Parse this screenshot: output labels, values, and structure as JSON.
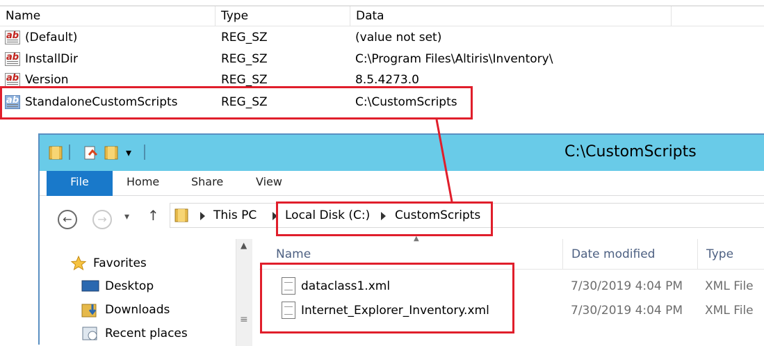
{
  "registry": {
    "columns": [
      "Name",
      "Type",
      "Data"
    ],
    "rows": [
      {
        "name": "(Default)",
        "type": "REG_SZ",
        "data": "(value not set)"
      },
      {
        "name": "InstallDir",
        "type": "REG_SZ",
        "data": "C:\\Program Files\\Altiris\\Inventory\\"
      },
      {
        "name": "Version",
        "type": "REG_SZ",
        "data": "8.5.4273.0"
      },
      {
        "name": "StandaloneCustomScripts",
        "type": "REG_SZ",
        "data": "C:\\CustomScripts"
      }
    ]
  },
  "explorer": {
    "title": "C:\\CustomScripts",
    "ribbon": {
      "file": "File",
      "tabs": [
        "Home",
        "Share",
        "View"
      ]
    },
    "breadcrumb": [
      "This PC",
      "Local Disk (C:)",
      "CustomScripts"
    ],
    "nav": {
      "favorites": "Favorites",
      "items": [
        "Desktop",
        "Downloads",
        "Recent places"
      ]
    },
    "columns": {
      "name": "Name",
      "date": "Date modified",
      "type": "Type"
    },
    "files": [
      {
        "name": "dataclass1.xml",
        "date": "7/30/2019 4:04 PM",
        "type": "XML File"
      },
      {
        "name": "Internet_Explorer_Inventory.xml",
        "date": "7/30/2019 4:04 PM",
        "type": "XML File"
      }
    ]
  },
  "colors": {
    "highlight": "#e01e2b",
    "titlebar": "#69cbe8",
    "file_tab": "#1979ca"
  },
  "icons": [
    "reg-string-icon",
    "folder-icon",
    "back-arrow-icon",
    "forward-arrow-icon",
    "up-arrow-icon",
    "star-icon",
    "desktop-icon",
    "downloads-icon",
    "recent-places-icon",
    "xml-file-icon"
  ]
}
